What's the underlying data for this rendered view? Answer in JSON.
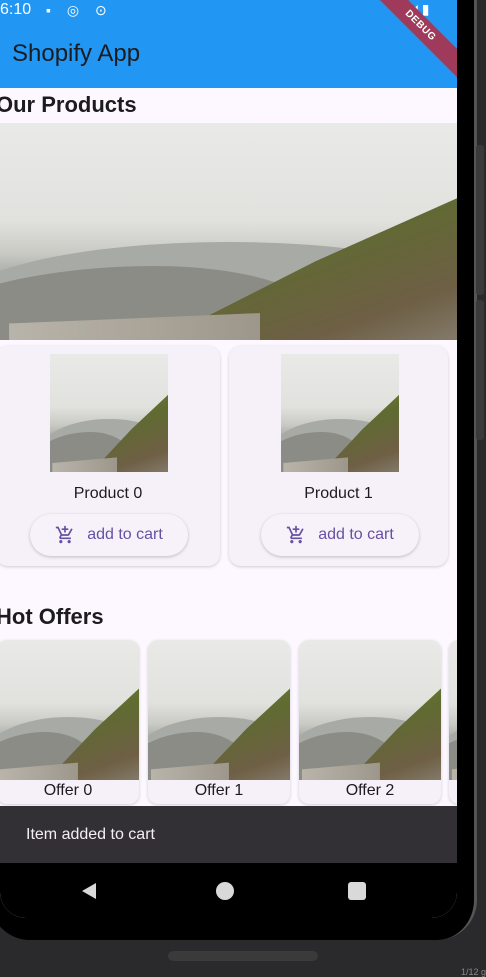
{
  "status_bar": {
    "time": "6:10",
    "left_icons": "▪ ◎ ⊙",
    "right_icons": "▾◢▮"
  },
  "app_bar": {
    "title": "Shopify App",
    "debug_banner": "DEBUG"
  },
  "products_section": {
    "title": "Our Products",
    "items": [
      {
        "name": "Product 0",
        "button_label": "add to cart"
      },
      {
        "name": "Product 1",
        "button_label": "add to cart"
      }
    ]
  },
  "offers_section": {
    "title": "Hot Offers",
    "items": [
      {
        "label": "Offer 0"
      },
      {
        "label": "Offer 1"
      },
      {
        "label": "Offer 2"
      }
    ]
  },
  "snackbar": {
    "message": "Item added to cart"
  },
  "nav_bar": {
    "icons": [
      "back-icon",
      "home-icon",
      "recents-icon"
    ]
  },
  "colors": {
    "app_bar": "#2196f3",
    "accent": "#6750a4",
    "background": "#fdf7ff",
    "snackbar": "#322f35"
  },
  "corner_text": "1/12 g"
}
